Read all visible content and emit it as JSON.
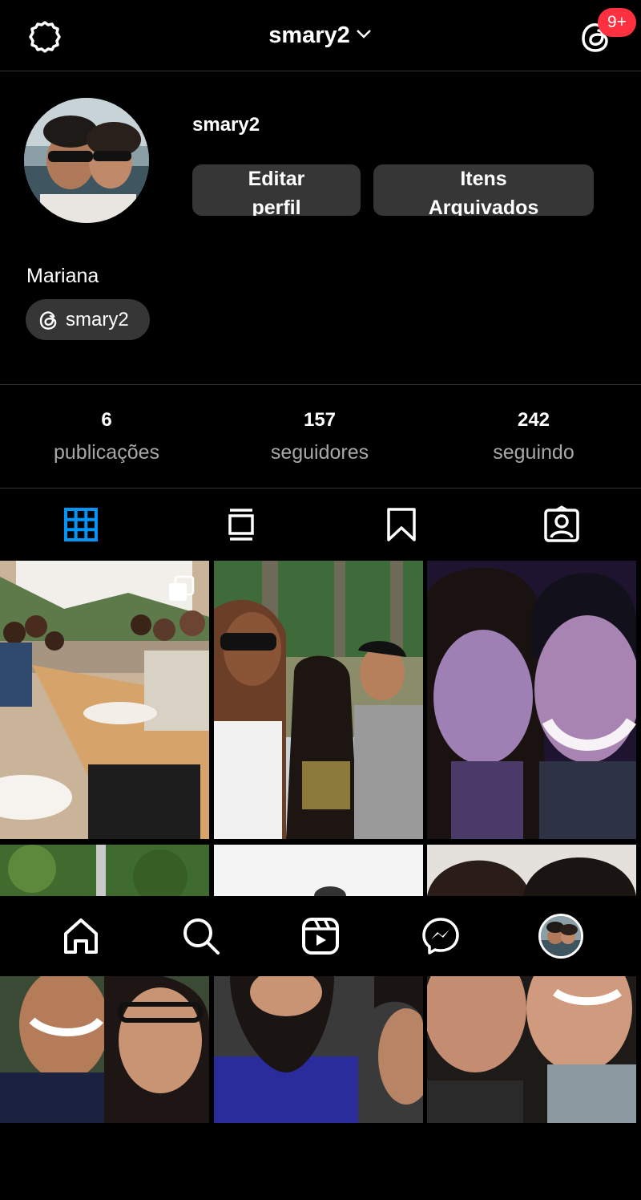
{
  "header": {
    "username": "smary2",
    "notification_badge": "9+",
    "icons": {
      "settings": "gear-icon",
      "dropdown": "chevron-down-icon",
      "threads": "threads-icon"
    }
  },
  "profile": {
    "username": "smary2",
    "edit_button": {
      "line1": "Editar",
      "line2": "perfil"
    },
    "archive_button": {
      "line1": "Itens",
      "line2": "Arquivados"
    },
    "full_name": "Mariana",
    "threads_handle": "smary2"
  },
  "stats": [
    {
      "value": "6",
      "label": "publicações"
    },
    {
      "value": "157",
      "label": "seguidores"
    },
    {
      "value": "242",
      "label": "seguindo"
    }
  ],
  "tabs": [
    {
      "icon": "grid-icon",
      "active": true
    },
    {
      "icon": "reels-feed-icon",
      "active": false
    },
    {
      "icon": "bookmark-icon",
      "active": false
    },
    {
      "icon": "tagged-icon",
      "active": false
    }
  ],
  "nav": [
    {
      "icon": "home-icon"
    },
    {
      "icon": "search-icon"
    },
    {
      "icon": "reels-icon"
    },
    {
      "icon": "messenger-icon"
    },
    {
      "icon": "profile-avatar"
    }
  ],
  "colors": {
    "background": "#000000",
    "divider": "#363636",
    "button": "#363636",
    "accent_blue": "#0095f6",
    "badge_red": "#ff3040",
    "muted_text": "#a8a8a8"
  }
}
